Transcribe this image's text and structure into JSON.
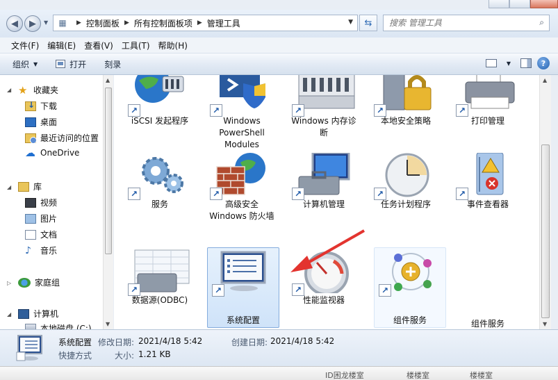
{
  "address": {
    "crumbs": [
      "控制面板",
      "所有控制面板项",
      "管理工具"
    ]
  },
  "search": {
    "placeholder": "搜索 管理工具"
  },
  "menu": [
    "文件(F)",
    "编辑(E)",
    "查看(V)",
    "工具(T)",
    "帮助(H)"
  ],
  "commands": {
    "organize": "组织",
    "open": "打开",
    "burn": "刻录"
  },
  "nav": {
    "favorites": "收藏夹",
    "downloads": "下载",
    "desktop": "桌面",
    "recent": "最近访问的位置",
    "onedrive": "OneDrive",
    "libraries": "库",
    "videos": "视频",
    "pictures": "图片",
    "documents": "文档",
    "music": "音乐",
    "homegroup": "家庭组",
    "computer": "计算机",
    "local_disk": "本地磁盘 (C:)"
  },
  "items": [
    {
      "label": "iSCSI 发起程序",
      "icon": "globe-network-icon"
    },
    {
      "label": "Windows PowerShell Modules",
      "icon": "powershell-icon"
    },
    {
      "label": "Windows 内存诊断",
      "icon": "memory-chip-icon"
    },
    {
      "label": "本地安全策略",
      "icon": "padlock-server-icon"
    },
    {
      "label": "打印管理",
      "icon": "printer-icon"
    },
    {
      "label": "服务",
      "icon": "gears-icon"
    },
    {
      "label": "高级安全 Windows 防火墙",
      "icon": "firewall-icon"
    },
    {
      "label": "计算机管理",
      "icon": "computer-toolbox-icon"
    },
    {
      "label": "任务计划程序",
      "icon": "clock-icon"
    },
    {
      "label": "事件查看器",
      "icon": "event-log-icon"
    },
    {
      "label": "数据源(ODBC)",
      "icon": "database-toolbox-icon"
    },
    {
      "label": "系统配置",
      "icon": "system-config-icon"
    },
    {
      "label": "性能监视器",
      "icon": "gauge-icon"
    },
    {
      "label": "组件服务",
      "icon": "component-services-icon"
    },
    {
      "label": "组件服务"
    }
  ],
  "details": {
    "name": "系统配置",
    "type": "快捷方式",
    "modified_label": "修改日期:",
    "modified_value": "2021/4/18 5:42",
    "created_label": "创建日期:",
    "created_value": "2021/4/18 5:42",
    "size_label": "大小:",
    "size_value": "1.21 KB"
  },
  "bottom_strip": [
    "ID困龙楼室",
    "楼楼室",
    "楼楼室"
  ],
  "colors": {
    "annotation_arrow": "#e3342f",
    "selection": "#cfe3f9"
  }
}
